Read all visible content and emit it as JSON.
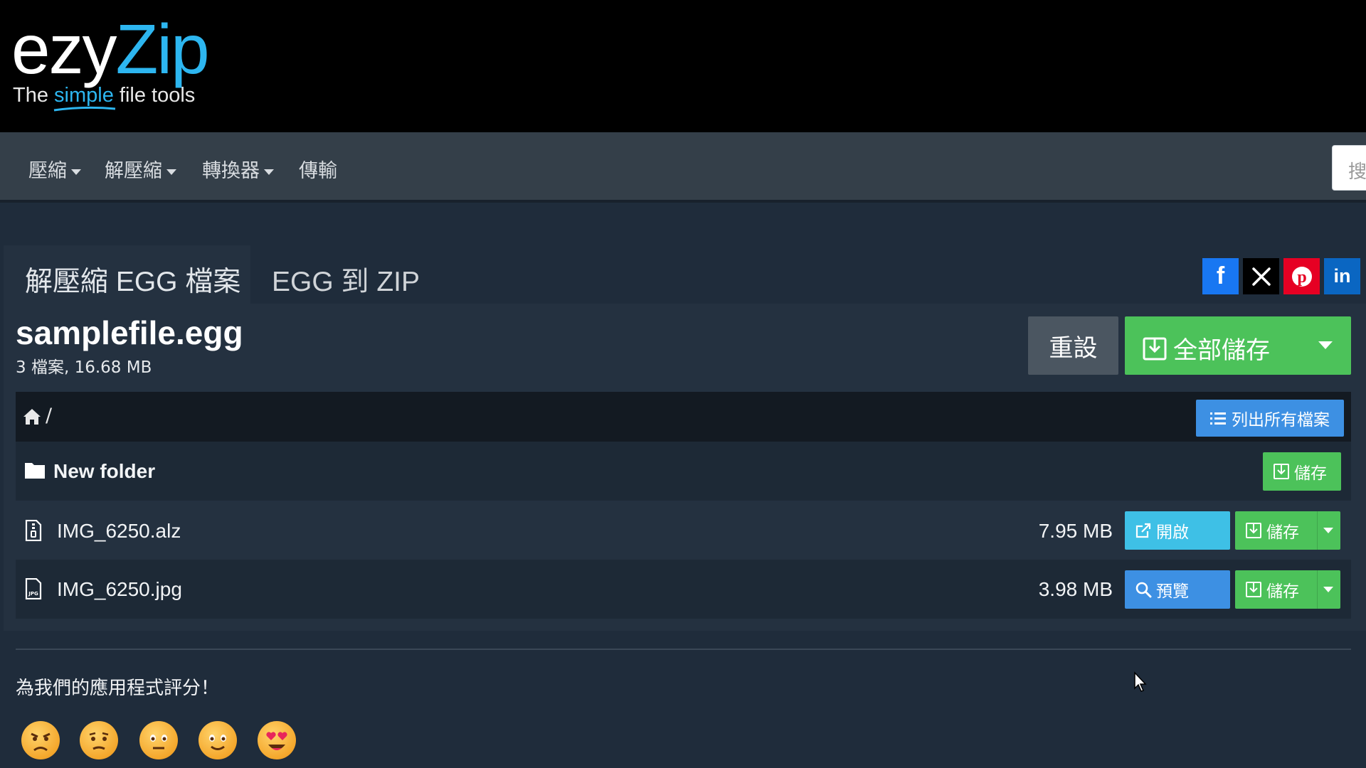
{
  "logo": {
    "word_part1": "ezy",
    "word_part2": "Zip",
    "tagline_pre": "The ",
    "tagline_highlight": "simple",
    "tagline_post": " file tools"
  },
  "nav": {
    "items": [
      {
        "label": "壓縮",
        "dropdown": true
      },
      {
        "label": "解壓縮",
        "dropdown": true
      },
      {
        "label": "轉換器",
        "dropdown": true
      },
      {
        "label": "傳輸",
        "dropdown": false
      }
    ],
    "search_text": "搜"
  },
  "tabs": [
    {
      "label": "解壓縮 EGG 檔案",
      "active": true
    },
    {
      "label": "EGG 到 ZIP",
      "active": false
    }
  ],
  "share": {
    "facebook": "f",
    "x": "𝕏",
    "linkedin": "in"
  },
  "archive": {
    "name": "samplefile.egg",
    "info": "3 檔案, 16.68 MB"
  },
  "actions": {
    "reset_label": "重設",
    "save_all_label": "全部儲存",
    "list_all_label": "列出所有檔案"
  },
  "path": "/",
  "files": [
    {
      "type": "folder",
      "name": "New folder",
      "size": "",
      "save_label": "儲存"
    },
    {
      "type": "file",
      "name": "IMG_6250.alz",
      "size": "7.95 MB",
      "action_label": "開啟",
      "save_label": "儲存"
    },
    {
      "type": "file",
      "name": "IMG_6250.jpg",
      "size": "3.98 MB",
      "action_label": "預覽",
      "save_label": "儲存"
    }
  ],
  "rating": {
    "title": "為我們的應用程式評分！",
    "options": [
      "angry-face-icon",
      "worried-face-icon",
      "neutral-face-icon",
      "smiling-face-icon",
      "heart-eyes-face-icon"
    ]
  },
  "colors": {
    "accent": "#2db6f0",
    "save_green": "#4cc25a",
    "open_cyan": "#3ec0e6",
    "preview_blue": "#3d90e3",
    "header_bg": "#000000",
    "nav_bg": "#343f49",
    "page_bg": "#1f2c3b"
  }
}
